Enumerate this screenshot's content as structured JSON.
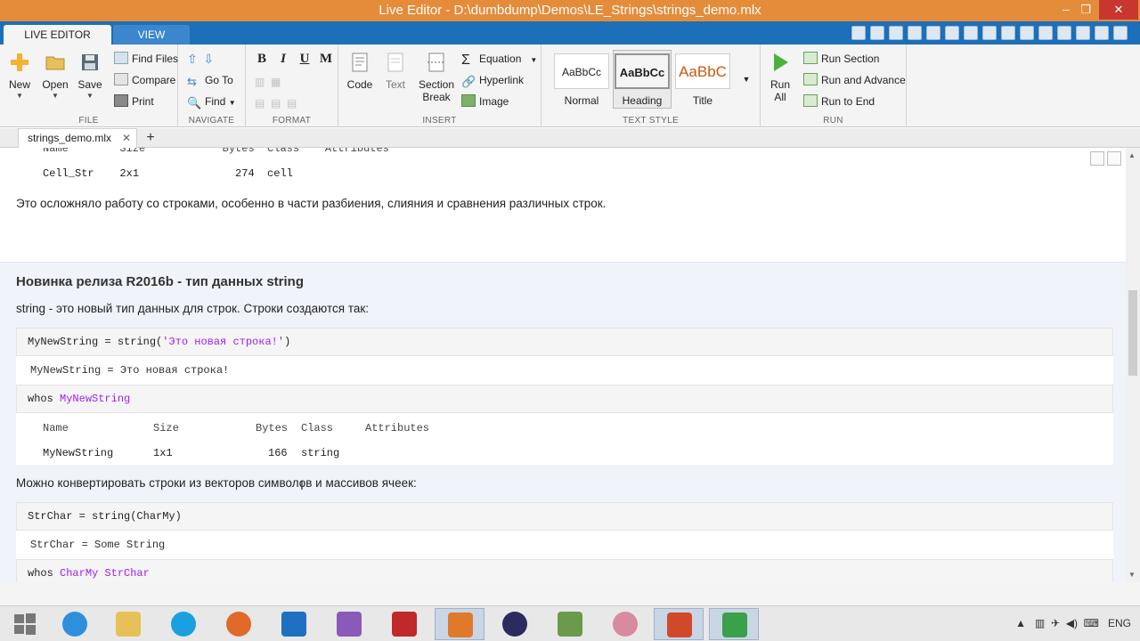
{
  "window": {
    "title": "Live Editor - D:\\dumbdump\\Demos\\LE_Strings\\strings_demo.mlx",
    "min": "–",
    "max": "❐",
    "close": "✕"
  },
  "tabs": [
    {
      "label": "LIVE EDITOR"
    },
    {
      "label": "VIEW"
    }
  ],
  "ribbon": {
    "file": {
      "label": "FILE",
      "new": "New",
      "open": "Open",
      "save": "Save",
      "find_files": "Find Files",
      "compare": "Compare",
      "print": "Print"
    },
    "navigate": {
      "label": "NAVIGATE",
      "go_to": "Go To",
      "find": "Find"
    },
    "format": {
      "label": "FORMAT",
      "bold": "B",
      "italic": "I",
      "underline": "U",
      "mono": "M"
    },
    "insert": {
      "label": "INSERT",
      "code": "Code",
      "text": "Text",
      "section_break_1": "Section",
      "section_break_2": "Break",
      "equation": "Equation",
      "hyperlink": "Hyperlink",
      "image": "Image"
    },
    "text_style": {
      "label": "TEXT STYLE",
      "styles": [
        {
          "sample": "AaBbCc",
          "name": "Normal"
        },
        {
          "sample": "AaBbCc",
          "name": "Heading"
        },
        {
          "sample": "AaBbC",
          "name": "Title"
        }
      ]
    },
    "run": {
      "label": "RUN",
      "run_all_1": "Run",
      "run_all_2": "All",
      "run_section": "Run Section",
      "run_and_advance": "Run and Advance",
      "run_to_end": "Run to End"
    }
  },
  "doc_tab": {
    "name": "strings_demo.mlx",
    "close": "✕",
    "add": "+"
  },
  "content": {
    "top_output": {
      "header": "Name        Size            Bytes  Class    Attributes",
      "row": "Cell_Str    2x1               274  cell"
    },
    "para1": "Это осложняло работу со строками, особенно в части разбиения, слияния и сравнения различных строк.",
    "heading": "Новинка релиза R2016b - тип данных string",
    "para2": "string - это новый тип данных для строк. Строки создаются так:",
    "code1_prefix": "MyNewString = string(",
    "code1_str": "'Это новая строка!'",
    "code1_suffix": ")",
    "out1": "MyNewString = Это новая строка!",
    "code2_prefix": "whos ",
    "code2_args": "MyNewString",
    "whos2_header": {
      "name": "Name",
      "size": "Size",
      "bytes": "Bytes",
      "class": "Class",
      "attributes": "Attributes"
    },
    "whos2_row": {
      "name": "MyNewString",
      "size": "1x1",
      "bytes": "166",
      "class": "string"
    },
    "para3": "Можно конвертировать строки из векторов символов и массивов ячеек:",
    "code3": "StrChar = string(CharMy)",
    "out3": "StrChar = Some String",
    "code4_prefix": "whos ",
    "code4_args": "CharMy StrChar"
  },
  "taskbar": {
    "apps": [
      "start",
      "internet-explorer",
      "file-explorer",
      "skype",
      "firefox",
      "outlook",
      "visual-studio",
      "acrobat",
      "matlab",
      "eclipse",
      "tools",
      "paint",
      "powerpoint",
      "camtasia"
    ],
    "lang": "ENG"
  }
}
